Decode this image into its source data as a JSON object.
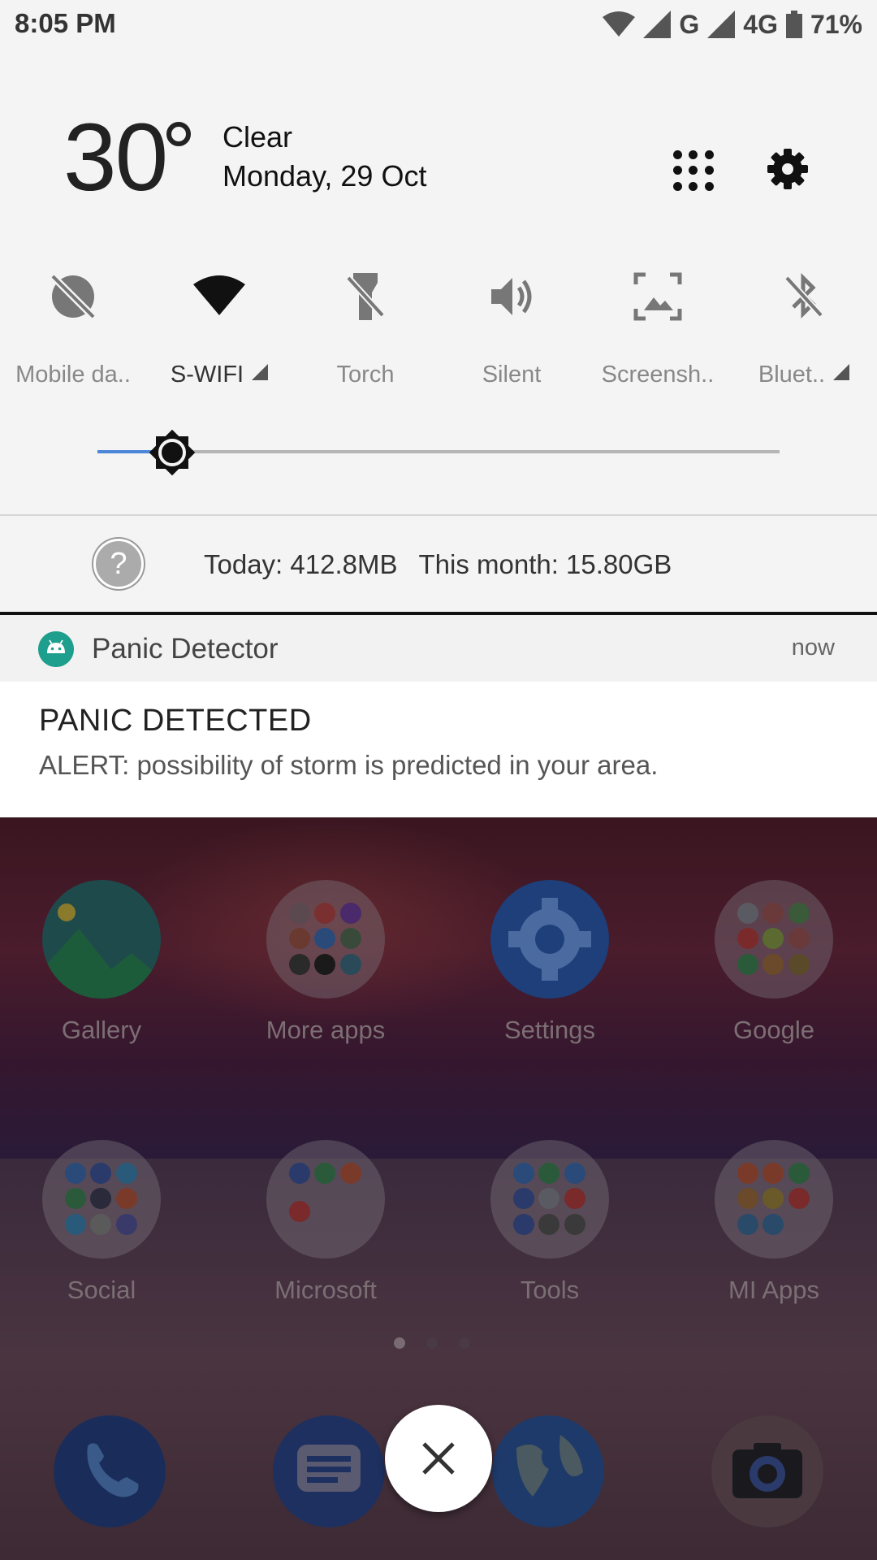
{
  "status_bar": {
    "time": "8:05 PM",
    "network_1": "G",
    "network_2": "4G",
    "battery": "71%",
    "icons": [
      "wifi-icon",
      "signal-icon",
      "signal-icon",
      "battery-icon"
    ]
  },
  "header": {
    "temperature": "30",
    "condition": "Clear",
    "date": "Monday, 29 Oct",
    "icons": [
      "apps-grid-icon",
      "gear-icon"
    ]
  },
  "quick_tiles": [
    {
      "label": "Mobile da..",
      "icon": "mobile-data-off-icon",
      "active": false
    },
    {
      "label": "S-WIFI",
      "icon": "wifi-icon",
      "active": true,
      "has_more": true
    },
    {
      "label": "Torch",
      "icon": "flashlight-off-icon",
      "active": false
    },
    {
      "label": "Silent",
      "icon": "volume-icon",
      "active": false
    },
    {
      "label": "Screensh..",
      "icon": "screenshot-icon",
      "active": false
    },
    {
      "label": "Bluet..",
      "icon": "bluetooth-off-icon",
      "active": false,
      "has_more": true
    }
  ],
  "brightness": {
    "level": 0.11,
    "icon": "brightness-icon"
  },
  "data_usage": {
    "today": "Today: 412.8MB",
    "month": "This month: 15.80GB",
    "help_symbol": "?"
  },
  "notification": {
    "app_name": "Panic Detector",
    "time": "now",
    "title": "PANIC DETECTED",
    "text": "ALERT: possibility of storm is predicted in your area.",
    "app_icon": "android-icon"
  },
  "home_screen": {
    "row1": [
      "Gallery",
      "More apps",
      "Settings",
      "Google"
    ],
    "row2": [
      "Social",
      "Microsoft",
      "Tools",
      "MI Apps"
    ],
    "dock_icons": [
      "phone-icon",
      "messages-icon",
      "browser-icon",
      "camera-icon"
    ],
    "page_index": 0,
    "page_count": 3
  },
  "colors": {
    "accent": "#4c86d8",
    "notif_icon": "#1e9e8c"
  }
}
